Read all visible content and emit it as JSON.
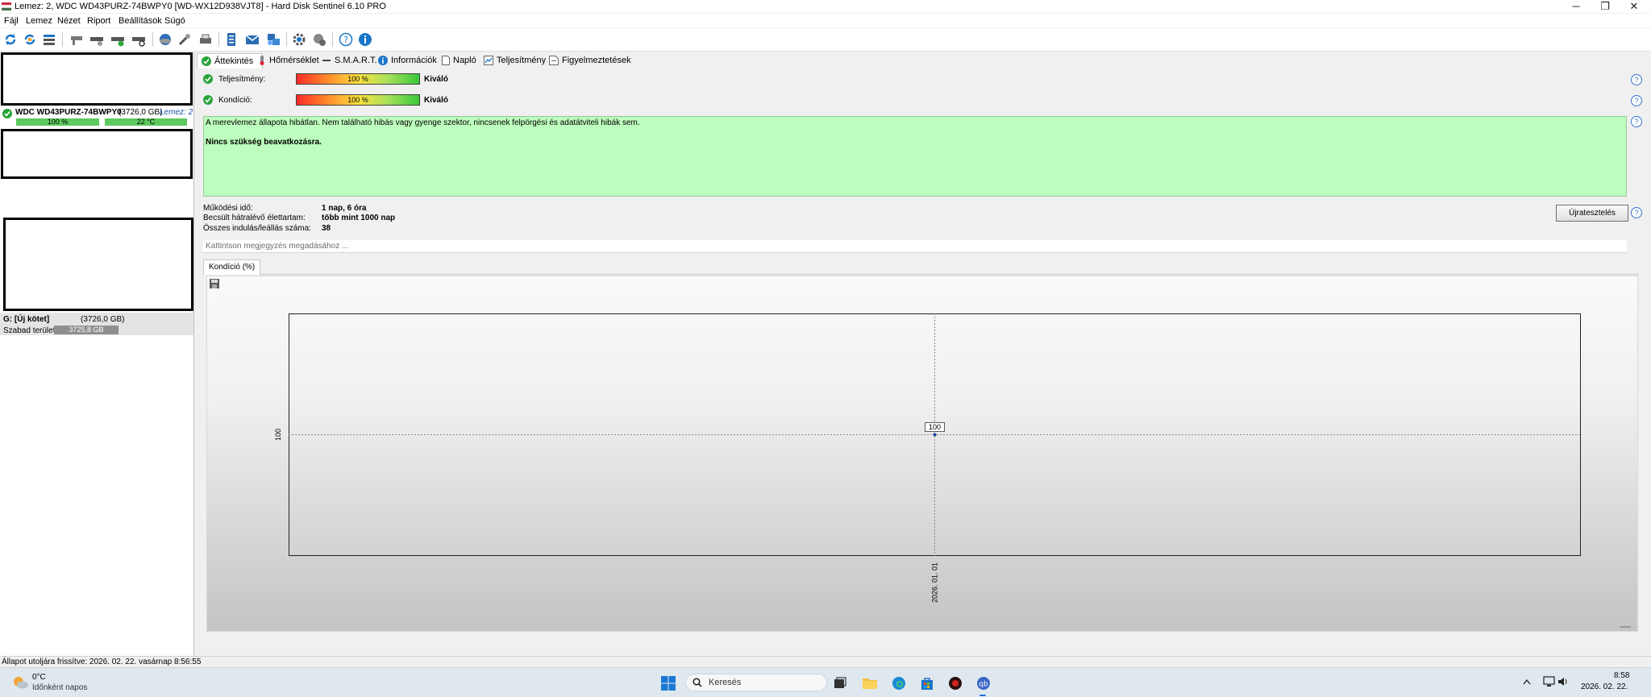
{
  "window": {
    "title": "Lemez: 2, WDC WD43PURZ-74BWPY0 [WD-WX12D938VJT8]  -  Hard Disk Sentinel 6.10 PRO",
    "minimize": "─",
    "maximize": "❐",
    "close": "✕"
  },
  "menu": [
    "Fájl",
    "Lemez",
    "Nézet",
    "Riport",
    "Beállítások",
    "Súgó"
  ],
  "left": {
    "disk_name": "WDC WD43PURZ-74BWPY0",
    "disk_size": "(3726,0 GB)",
    "disk_tag": "Lemez: 2",
    "health_pct": "100 %",
    "temp": "22 °C",
    "volume_name": "G: [Új kötet]",
    "volume_size": "(3726,0 GB)",
    "free_label": "Szabad terület",
    "free_value": "3725,8 GB"
  },
  "tabs": [
    "Áttekintés",
    "Hőmérséklet",
    "S.M.A.R.T.",
    "Információk",
    "Napló",
    "Teljesítmény",
    "Figyelmeztetések"
  ],
  "overview": {
    "perf_label": "Teljesítmény:",
    "perf_pct": "100 %",
    "perf_rating": "Kiváló",
    "cond_label": "Kondíció:",
    "cond_pct": "100 %",
    "cond_rating": "Kiváló",
    "status_text": "A merevlemez állapota hibátlan. Nem található hibás vagy gyenge szektor, nincsenek felpörgési és adatátviteli hibák sem.",
    "status_bold": "Nincs szükség beavatkozásra.",
    "uptime_label": "Működési idő:",
    "uptime_value": "1 nap, 6 óra",
    "life_label": "Becsült hátralévő élettartam:",
    "life_value": "több mint 1000 nap",
    "starts_label": "Összes indulás/leállás száma:",
    "starts_value": "38",
    "retest_button": "Újratesztelés",
    "note_placeholder": "Kattintson megjegyzés megadásához ...",
    "help": "?"
  },
  "chart_tab": "Kondíció  (%)",
  "chart_data": {
    "type": "line",
    "x": [
      "2026. 01. 01"
    ],
    "series": [
      {
        "values": [
          100
        ]
      }
    ],
    "ylabel": "",
    "ytick": "100",
    "data_label": "100"
  },
  "statusbar": "Állapot utoljára frissítve: 2026. 02. 22. vasárnap 8:56:55",
  "taskbar": {
    "weather_temp": "0°C",
    "weather_desc": "Időnként napos",
    "search": "Keresés",
    "time": "8:58",
    "date": "2026. 02. 22."
  }
}
